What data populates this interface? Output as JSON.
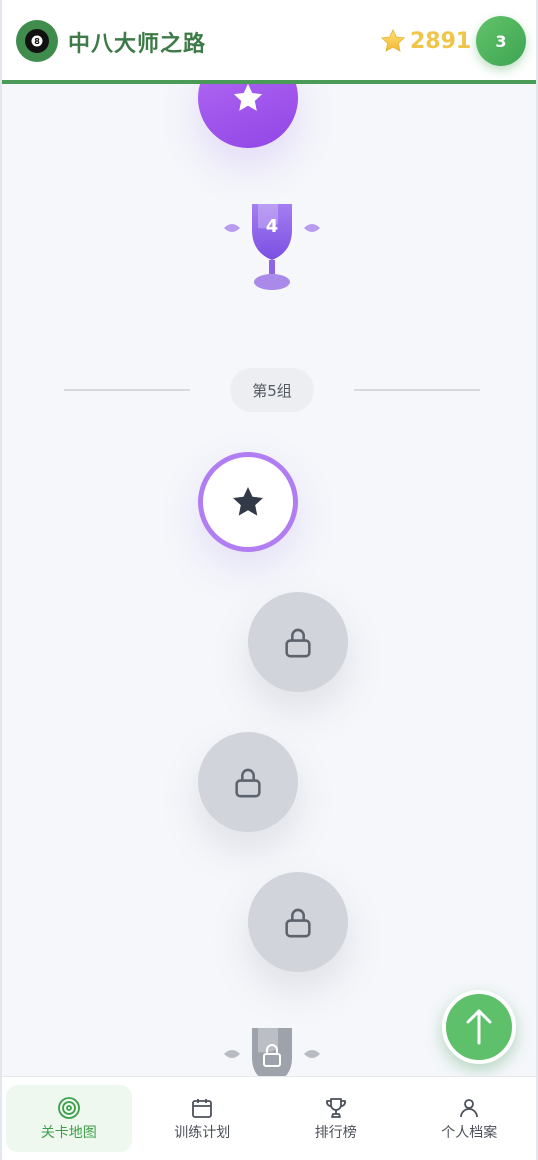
{
  "header": {
    "title": "中八大师之路",
    "logo_icon": "eight-ball-icon",
    "stars_value": "2891",
    "level_badge": "3"
  },
  "map": {
    "trophy_number": "4",
    "group_label": "第5组",
    "nodes": [
      {
        "state": "completed",
        "icon": "star-icon"
      },
      {
        "state": "current",
        "icon": "star-icon"
      },
      {
        "state": "locked",
        "icon": "lock-icon"
      },
      {
        "state": "locked",
        "icon": "lock-icon"
      },
      {
        "state": "locked",
        "icon": "lock-icon"
      }
    ]
  },
  "fab": {
    "icon": "arrow-up-icon"
  },
  "bottom_nav": {
    "items": [
      {
        "label": "关卡地图",
        "icon": "target-icon",
        "active": true
      },
      {
        "label": "训练计划",
        "icon": "calendar-icon",
        "active": false
      },
      {
        "label": "排行榜",
        "icon": "trophy-icon",
        "active": false
      },
      {
        "label": "个人档案",
        "icon": "user-icon",
        "active": false
      }
    ]
  },
  "colors": {
    "brand_green": "#3e7a47",
    "accent_green": "#5ec06a",
    "star_gold": "#f0c64a",
    "completed_purple": "#9145e6",
    "locked_gray": "#d1d4da"
  }
}
